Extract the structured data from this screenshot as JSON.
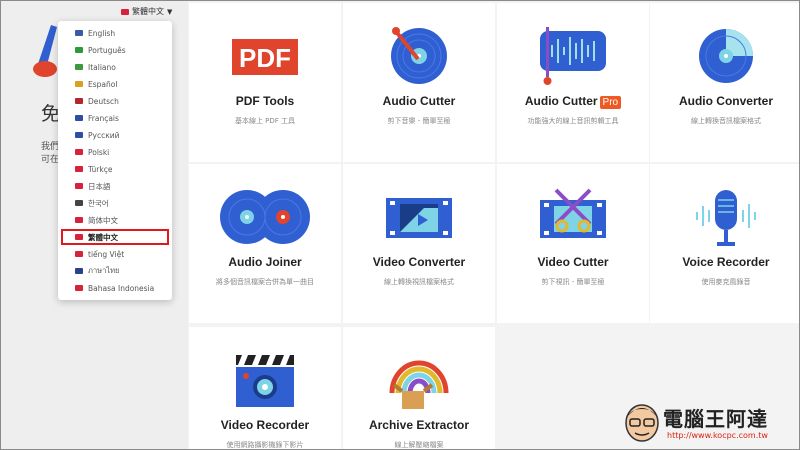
{
  "hero": {
    "title_partial": "免",
    "desc_line1": "我們",
    "desc_line2": "可在"
  },
  "language": {
    "current": "繁體中文",
    "items": [
      {
        "label": "English",
        "flag": "#3a5ba7"
      },
      {
        "label": "Português",
        "flag": "#2a9a3d"
      },
      {
        "label": "Italiano",
        "flag": "#3a9a3d"
      },
      {
        "label": "Español",
        "flag": "#d9a021"
      },
      {
        "label": "Deutsch",
        "flag": "#b5262b"
      },
      {
        "label": "Français",
        "flag": "#2d4ea3"
      },
      {
        "label": "Русский",
        "flag": "#2d4ea3"
      },
      {
        "label": "Polski",
        "flag": "#d8213a"
      },
      {
        "label": "Türkçe",
        "flag": "#d8213a"
      },
      {
        "label": "日本語",
        "flag": "#d8213a"
      },
      {
        "label": "한국어",
        "flag": "#444444"
      },
      {
        "label": "简体中文",
        "flag": "#d8213a"
      },
      {
        "label": "繁體中文",
        "flag": "#d8213a"
      },
      {
        "label": "tiếng Việt",
        "flag": "#d8213a"
      },
      {
        "label": "ภาษาไทย",
        "flag": "#2d3e8a"
      },
      {
        "label": "Bahasa Indonesia",
        "flag": "#d8213a"
      }
    ],
    "selected_index": 12
  },
  "tools": [
    {
      "title": "PDF Tools",
      "desc": "基本線上 PDF 工具",
      "pro": "",
      "icon": "pdf-icon"
    },
    {
      "title": "Audio Cutter",
      "desc": "剪下音樂 - 簡單至極",
      "pro": "",
      "icon": "audio-cutter-icon"
    },
    {
      "title": "Audio Cutter",
      "desc": "功能強大的線上音訊剪輯工具",
      "pro": "Pro",
      "icon": "audio-cutter-pro-icon"
    },
    {
      "title": "Audio Converter",
      "desc": "線上轉換音訊檔案格式",
      "pro": "",
      "icon": "audio-converter-icon"
    },
    {
      "title": "Audio Joiner",
      "desc": "將多個音訊檔案合併為單一曲目",
      "pro": "",
      "icon": "audio-joiner-icon"
    },
    {
      "title": "Video Converter",
      "desc": "線上轉換視訊檔案格式",
      "pro": "",
      "icon": "video-converter-icon"
    },
    {
      "title": "Video Cutter",
      "desc": "剪下視訊 - 簡單至極",
      "pro": "",
      "icon": "video-cutter-icon"
    },
    {
      "title": "Voice Recorder",
      "desc": "使用麥克風錄音",
      "pro": "",
      "icon": "microphone-icon"
    },
    {
      "title": "Video Recorder",
      "desc": "使用網路攝影機錄下影片",
      "pro": "",
      "icon": "video-recorder-icon"
    },
    {
      "title": "Archive Extractor",
      "desc": "線上解壓縮檔案",
      "pro": "",
      "icon": "archive-icon"
    }
  ],
  "watermark": {
    "text": "電腦王阿達",
    "url": "http://www.kocpc.com.tw"
  },
  "colors": {
    "accent_blue": "#2f5fd0",
    "accent_red": "#e0191d",
    "pro_orange": "#ef5a24"
  }
}
